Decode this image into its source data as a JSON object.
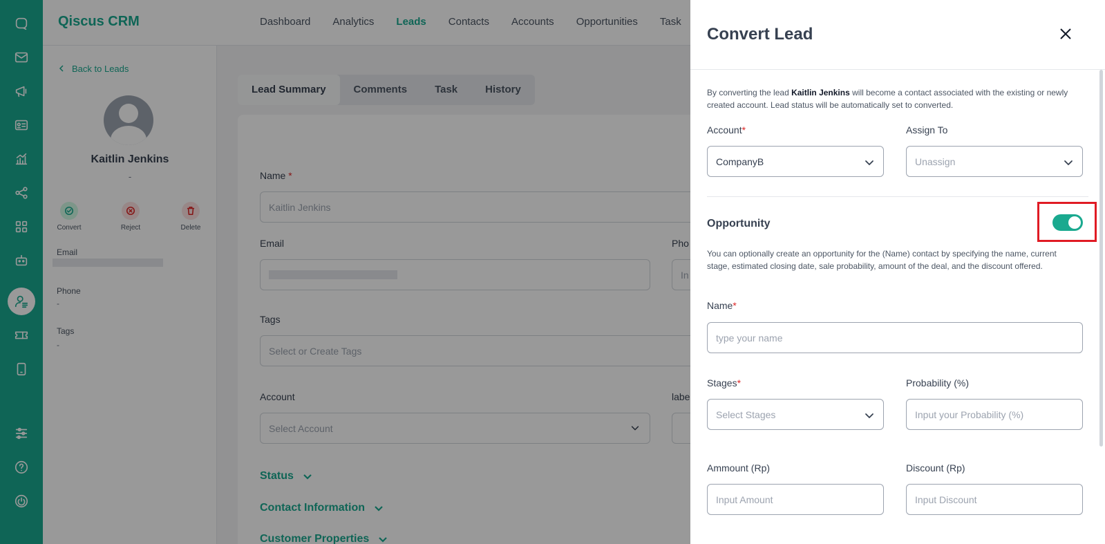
{
  "app": {
    "brand": "Qiscus CRM"
  },
  "nav": {
    "items": [
      "Dashboard",
      "Analytics",
      "Leads",
      "Contacts",
      "Accounts",
      "Opportunities",
      "Task"
    ],
    "active": "Leads"
  },
  "rail": {
    "icons": [
      "chat-icon",
      "mail-icon",
      "megaphone-icon",
      "contact-card-icon",
      "chart-icon",
      "share-icon",
      "apps-grid-icon",
      "robot-icon",
      "crm-user-icon",
      "ticket-icon",
      "tablet-icon",
      "settings-sliders-icon",
      "help-icon",
      "power-icon"
    ],
    "active": "crm-user-icon"
  },
  "profile": {
    "back_label": "Back to Leads",
    "name": "Kaitlin Jenkins",
    "subtitle": "-",
    "actions": {
      "convert": "Convert",
      "reject": "Reject",
      "delete": "Delete"
    },
    "email_label": "Email",
    "phone_label": "Phone",
    "phone_value": "-",
    "tags_label": "Tags",
    "tags_value": "-"
  },
  "tabs": [
    "Lead Summary",
    "Comments",
    "Task",
    "History"
  ],
  "form": {
    "name_label": "Name",
    "name_required": "*",
    "name_value": "Kaitlin Jenkins",
    "email_label": "Email",
    "phone_label": "Pho",
    "phone_placeholder": "In",
    "tags_label": "Tags",
    "tags_placeholder": "Select or Create Tags",
    "account_label": "Account",
    "account_placeholder": "Select Account",
    "label_label": "labe",
    "sections": [
      "Status",
      "Contact Information",
      "Customer Properties"
    ]
  },
  "drawer": {
    "title": "Convert Lead",
    "intro_prefix": "By converting the lead ",
    "intro_name": "Kaitlin Jenkins",
    "intro_suffix": " will become a contact associated with the existing or newly created account. Lead status will be automatically set to converted.",
    "account_label": "Account",
    "required_mark": "*",
    "account_value": "CompanyB",
    "assign_label": "Assign To",
    "assign_value": "Unassign",
    "opportunity_title": "Opportunity",
    "opportunity_enabled": true,
    "opportunity_desc": "You can optionally create an opportunity for the (Name) contact by specifying the name, current stage, estimated closing date, sale probability, amount of the deal, and the discount offered.",
    "opp_name_label": "Name",
    "opp_name_placeholder": "type your name",
    "stages_label": "Stages",
    "stages_placeholder": "Select Stages",
    "probability_label": "Probability (%)",
    "probability_placeholder": "Input your Probability (%)",
    "amount_label": "Ammount (Rp)",
    "amount_placeholder": "Input Amount",
    "discount_label": "Discount (Rp)",
    "discount_placeholder": "Input Discount"
  },
  "colors": {
    "brand": "#1aa98f",
    "danger": "#dc2626",
    "highlight": "#e01b24"
  }
}
